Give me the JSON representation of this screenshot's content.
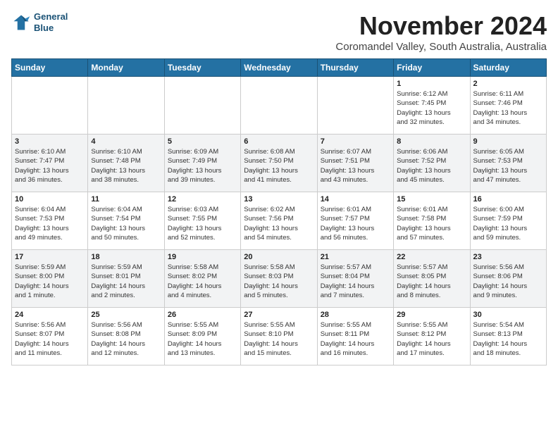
{
  "header": {
    "logo_line1": "General",
    "logo_line2": "Blue",
    "month_title": "November 2024",
    "location": "Coromandel Valley, South Australia, Australia"
  },
  "days_of_week": [
    "Sunday",
    "Monday",
    "Tuesday",
    "Wednesday",
    "Thursday",
    "Friday",
    "Saturday"
  ],
  "weeks": [
    [
      {
        "day": "",
        "info": ""
      },
      {
        "day": "",
        "info": ""
      },
      {
        "day": "",
        "info": ""
      },
      {
        "day": "",
        "info": ""
      },
      {
        "day": "",
        "info": ""
      },
      {
        "day": "1",
        "info": "Sunrise: 6:12 AM\nSunset: 7:45 PM\nDaylight: 13 hours\nand 32 minutes."
      },
      {
        "day": "2",
        "info": "Sunrise: 6:11 AM\nSunset: 7:46 PM\nDaylight: 13 hours\nand 34 minutes."
      }
    ],
    [
      {
        "day": "3",
        "info": "Sunrise: 6:10 AM\nSunset: 7:47 PM\nDaylight: 13 hours\nand 36 minutes."
      },
      {
        "day": "4",
        "info": "Sunrise: 6:10 AM\nSunset: 7:48 PM\nDaylight: 13 hours\nand 38 minutes."
      },
      {
        "day": "5",
        "info": "Sunrise: 6:09 AM\nSunset: 7:49 PM\nDaylight: 13 hours\nand 39 minutes."
      },
      {
        "day": "6",
        "info": "Sunrise: 6:08 AM\nSunset: 7:50 PM\nDaylight: 13 hours\nand 41 minutes."
      },
      {
        "day": "7",
        "info": "Sunrise: 6:07 AM\nSunset: 7:51 PM\nDaylight: 13 hours\nand 43 minutes."
      },
      {
        "day": "8",
        "info": "Sunrise: 6:06 AM\nSunset: 7:52 PM\nDaylight: 13 hours\nand 45 minutes."
      },
      {
        "day": "9",
        "info": "Sunrise: 6:05 AM\nSunset: 7:53 PM\nDaylight: 13 hours\nand 47 minutes."
      }
    ],
    [
      {
        "day": "10",
        "info": "Sunrise: 6:04 AM\nSunset: 7:53 PM\nDaylight: 13 hours\nand 49 minutes."
      },
      {
        "day": "11",
        "info": "Sunrise: 6:04 AM\nSunset: 7:54 PM\nDaylight: 13 hours\nand 50 minutes."
      },
      {
        "day": "12",
        "info": "Sunrise: 6:03 AM\nSunset: 7:55 PM\nDaylight: 13 hours\nand 52 minutes."
      },
      {
        "day": "13",
        "info": "Sunrise: 6:02 AM\nSunset: 7:56 PM\nDaylight: 13 hours\nand 54 minutes."
      },
      {
        "day": "14",
        "info": "Sunrise: 6:01 AM\nSunset: 7:57 PM\nDaylight: 13 hours\nand 56 minutes."
      },
      {
        "day": "15",
        "info": "Sunrise: 6:01 AM\nSunset: 7:58 PM\nDaylight: 13 hours\nand 57 minutes."
      },
      {
        "day": "16",
        "info": "Sunrise: 6:00 AM\nSunset: 7:59 PM\nDaylight: 13 hours\nand 59 minutes."
      }
    ],
    [
      {
        "day": "17",
        "info": "Sunrise: 5:59 AM\nSunset: 8:00 PM\nDaylight: 14 hours\nand 1 minute."
      },
      {
        "day": "18",
        "info": "Sunrise: 5:59 AM\nSunset: 8:01 PM\nDaylight: 14 hours\nand 2 minutes."
      },
      {
        "day": "19",
        "info": "Sunrise: 5:58 AM\nSunset: 8:02 PM\nDaylight: 14 hours\nand 4 minutes."
      },
      {
        "day": "20",
        "info": "Sunrise: 5:58 AM\nSunset: 8:03 PM\nDaylight: 14 hours\nand 5 minutes."
      },
      {
        "day": "21",
        "info": "Sunrise: 5:57 AM\nSunset: 8:04 PM\nDaylight: 14 hours\nand 7 minutes."
      },
      {
        "day": "22",
        "info": "Sunrise: 5:57 AM\nSunset: 8:05 PM\nDaylight: 14 hours\nand 8 minutes."
      },
      {
        "day": "23",
        "info": "Sunrise: 5:56 AM\nSunset: 8:06 PM\nDaylight: 14 hours\nand 9 minutes."
      }
    ],
    [
      {
        "day": "24",
        "info": "Sunrise: 5:56 AM\nSunset: 8:07 PM\nDaylight: 14 hours\nand 11 minutes."
      },
      {
        "day": "25",
        "info": "Sunrise: 5:56 AM\nSunset: 8:08 PM\nDaylight: 14 hours\nand 12 minutes."
      },
      {
        "day": "26",
        "info": "Sunrise: 5:55 AM\nSunset: 8:09 PM\nDaylight: 14 hours\nand 13 minutes."
      },
      {
        "day": "27",
        "info": "Sunrise: 5:55 AM\nSunset: 8:10 PM\nDaylight: 14 hours\nand 15 minutes."
      },
      {
        "day": "28",
        "info": "Sunrise: 5:55 AM\nSunset: 8:11 PM\nDaylight: 14 hours\nand 16 minutes."
      },
      {
        "day": "29",
        "info": "Sunrise: 5:55 AM\nSunset: 8:12 PM\nDaylight: 14 hours\nand 17 minutes."
      },
      {
        "day": "30",
        "info": "Sunrise: 5:54 AM\nSunset: 8:13 PM\nDaylight: 14 hours\nand 18 minutes."
      }
    ]
  ]
}
